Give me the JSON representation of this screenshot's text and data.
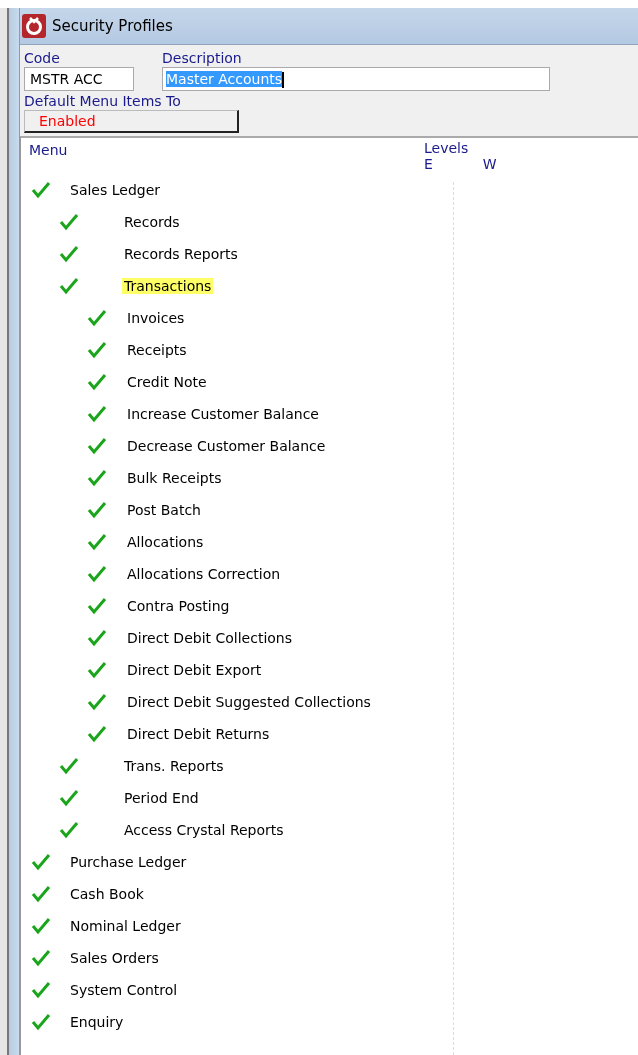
{
  "window": {
    "title": "Security Profiles"
  },
  "code": {
    "label": "Code",
    "value": "MSTR ACC"
  },
  "description": {
    "label": "Description",
    "value": "Master Accounts",
    "text_selected": true
  },
  "default_menu_items": {
    "label": "Default Menu Items To",
    "value": "Enabled"
  },
  "tree": {
    "columns": [
      {
        "label": "Menu"
      },
      {
        "label": "Levels"
      }
    ],
    "level_columns": [
      "E",
      "W"
    ],
    "items": [
      {
        "label": "Sales Ledger",
        "checked": true,
        "selected": false,
        "children": [
          {
            "label": "Records",
            "checked": true,
            "selected": false
          },
          {
            "label": "Records Reports",
            "checked": true,
            "selected": false
          },
          {
            "label": "Transactions",
            "checked": true,
            "selected": true,
            "children": [
              {
                "label": "Invoices",
                "checked": true,
                "selected": false
              },
              {
                "label": "Receipts",
                "checked": true,
                "selected": false
              },
              {
                "label": "Credit Note",
                "checked": true,
                "selected": false
              },
              {
                "label": "Increase Customer Balance",
                "checked": true,
                "selected": false
              },
              {
                "label": "Decrease Customer Balance",
                "checked": true,
                "selected": false
              },
              {
                "label": "Bulk Receipts",
                "checked": true,
                "selected": false
              },
              {
                "label": "Post Batch",
                "checked": true,
                "selected": false
              },
              {
                "label": "Allocations",
                "checked": true,
                "selected": false
              },
              {
                "label": "Allocations Correction",
                "checked": true,
                "selected": false
              },
              {
                "label": "Contra Posting",
                "checked": true,
                "selected": false
              },
              {
                "label": "Direct Debit Collections",
                "checked": true,
                "selected": false
              },
              {
                "label": "Direct Debit Export",
                "checked": true,
                "selected": false
              },
              {
                "label": "Direct Debit Suggested Collections",
                "checked": true,
                "selected": false
              },
              {
                "label": "Direct Debit Returns",
                "checked": true,
                "selected": false
              }
            ]
          },
          {
            "label": "Trans. Reports",
            "checked": true,
            "selected": false
          },
          {
            "label": "Period End",
            "checked": true,
            "selected": false
          },
          {
            "label": "Access Crystal Reports",
            "checked": true,
            "selected": false
          }
        ]
      },
      {
        "label": "Purchase Ledger",
        "checked": true,
        "selected": false
      },
      {
        "label": "Cash Book",
        "checked": true,
        "selected": false
      },
      {
        "label": "Nominal Ledger",
        "checked": true,
        "selected": false
      },
      {
        "label": "Sales Orders",
        "checked": true,
        "selected": false
      },
      {
        "label": "System Control",
        "checked": true,
        "selected": false
      },
      {
        "label": "Enquiry",
        "checked": true,
        "selected": false
      }
    ]
  }
}
